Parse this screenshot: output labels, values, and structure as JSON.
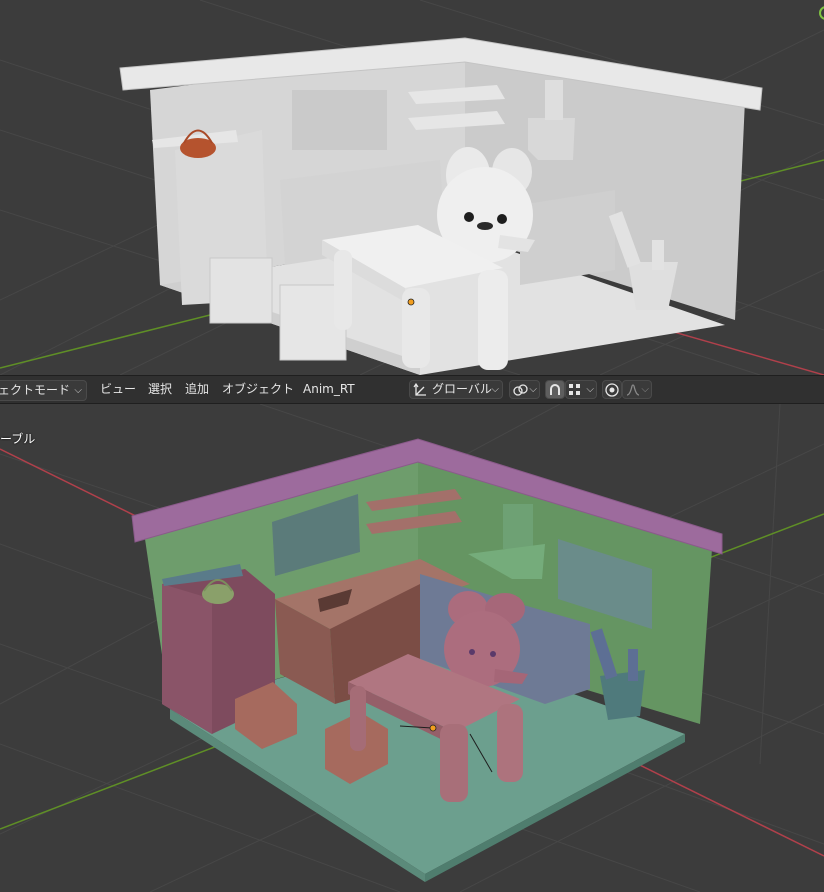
{
  "header": {
    "mode_label": "ジェクトモード",
    "menu": [
      "ビュー",
      "選択",
      "追加",
      "オブジェクト",
      "Anim_RT"
    ],
    "transform_orientation": "グローバル"
  },
  "bottom_viewport": {
    "object_label": "ーブル"
  },
  "icons": {
    "orientation": "transform-orientation-icon",
    "pivot": "pivot-point-icon",
    "snap_magnet": "snap-magnet-icon",
    "snap_grid": "snap-grid-icon",
    "proportional": "proportional-edit-icon",
    "falloff": "falloff-curve-icon"
  },
  "colors": {
    "viewport_bg": "#3c3c3c",
    "grid_line": "#4a4a4a",
    "x_axis": "#b8404d",
    "y_axis": "#6a9a2a",
    "solid_clay": "#dadada",
    "wall": "#6d9a6d",
    "trim": "#9c6a9c",
    "floor": "#6b9c8c",
    "counter": "#7a5048",
    "cabinet": "#7c4a5c",
    "fridge": "#6a7790",
    "bunny": "#a86a7a",
    "window": "#5a7a78"
  }
}
